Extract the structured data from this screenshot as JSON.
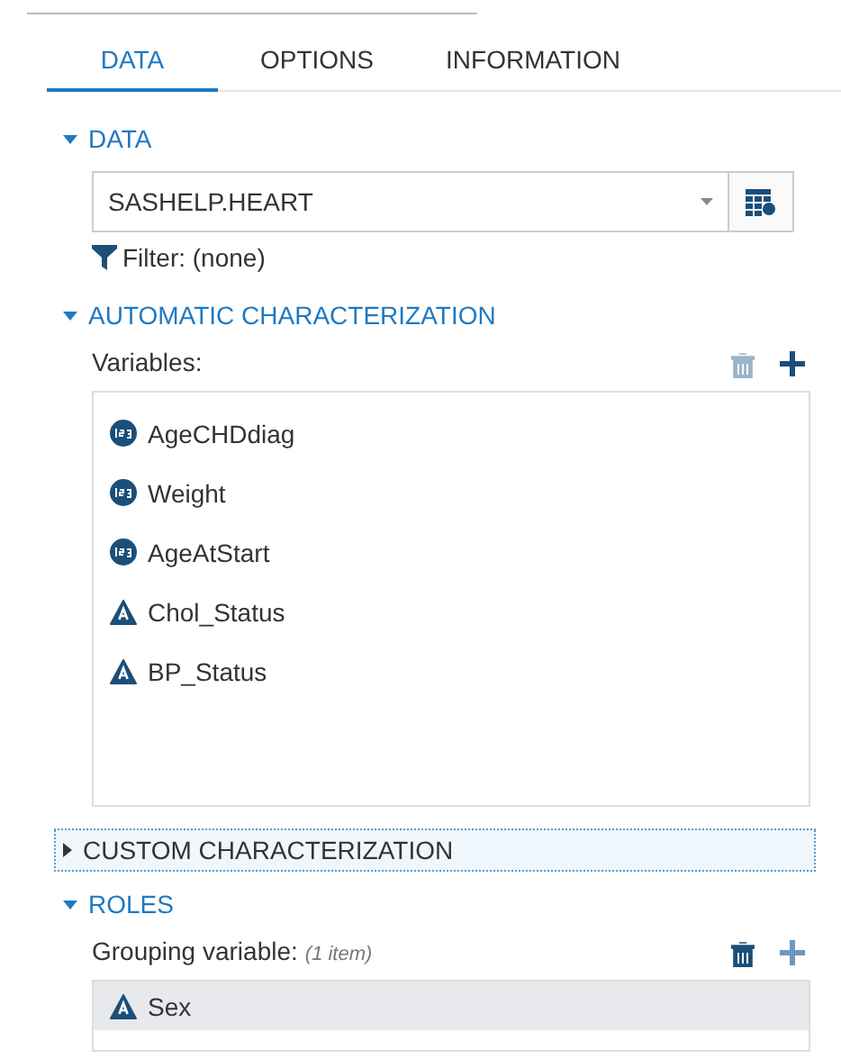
{
  "tabs": [
    {
      "label": "DATA",
      "selected": true
    },
    {
      "label": "OPTIONS",
      "selected": false
    },
    {
      "label": "INFORMATION",
      "selected": false
    }
  ],
  "sections": [
    {
      "kind": "data",
      "title": "DATA",
      "expanded": true,
      "dataset": "SASHELP.HEART",
      "filter": "Filter: (none)"
    },
    {
      "kind": "list",
      "title": "AUTOMATIC CHARACTERIZATION",
      "expanded": true,
      "label": "Variables:",
      "delete_disabled": true,
      "add_disabled": false,
      "items": [
        {
          "name": "AgeCHDdiag",
          "kind": "numeric",
          "selected": false
        },
        {
          "name": "Weight",
          "kind": "numeric",
          "selected": false
        },
        {
          "name": "AgeAtStart",
          "kind": "numeric",
          "selected": false
        },
        {
          "name": "Chol_Status",
          "kind": "character",
          "selected": false
        },
        {
          "name": "BP_Status",
          "kind": "character",
          "selected": false
        }
      ]
    },
    {
      "kind": "header",
      "title": "CUSTOM CHARACTERIZATION",
      "expanded": false,
      "focused": true
    },
    {
      "kind": "role",
      "title": "ROLES",
      "expanded": true,
      "label": "Grouping variable:",
      "note": "(1 item)",
      "delete_disabled": false,
      "add_disabled": true,
      "items": [
        {
          "name": "Sex",
          "kind": "character",
          "selected": true
        }
      ]
    }
  ]
}
